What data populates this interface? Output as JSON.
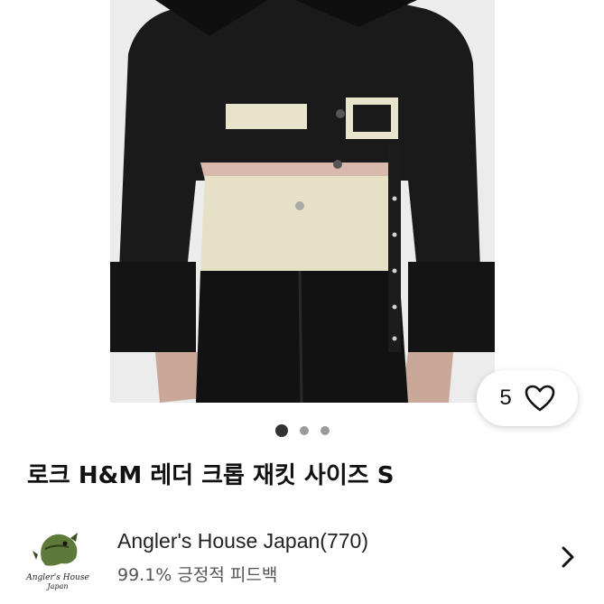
{
  "listing": {
    "title": "로크 H&M 레더 크롭 재킷 사이즈 S",
    "like_count": "5",
    "image_count": 3,
    "active_image": 1
  },
  "seller": {
    "name": "Angler's House Japan(770)",
    "feedback": "99.1% 긍정적 피드백",
    "avatar_text_line1": "Angler's House",
    "avatar_text_line2": "Japan"
  },
  "colors": {
    "accent": "#111111",
    "dot_active": "#333333",
    "dot_inactive": "#9a9a9a"
  },
  "icons": {
    "like": "heart-icon",
    "next": "chevron-right-icon"
  }
}
